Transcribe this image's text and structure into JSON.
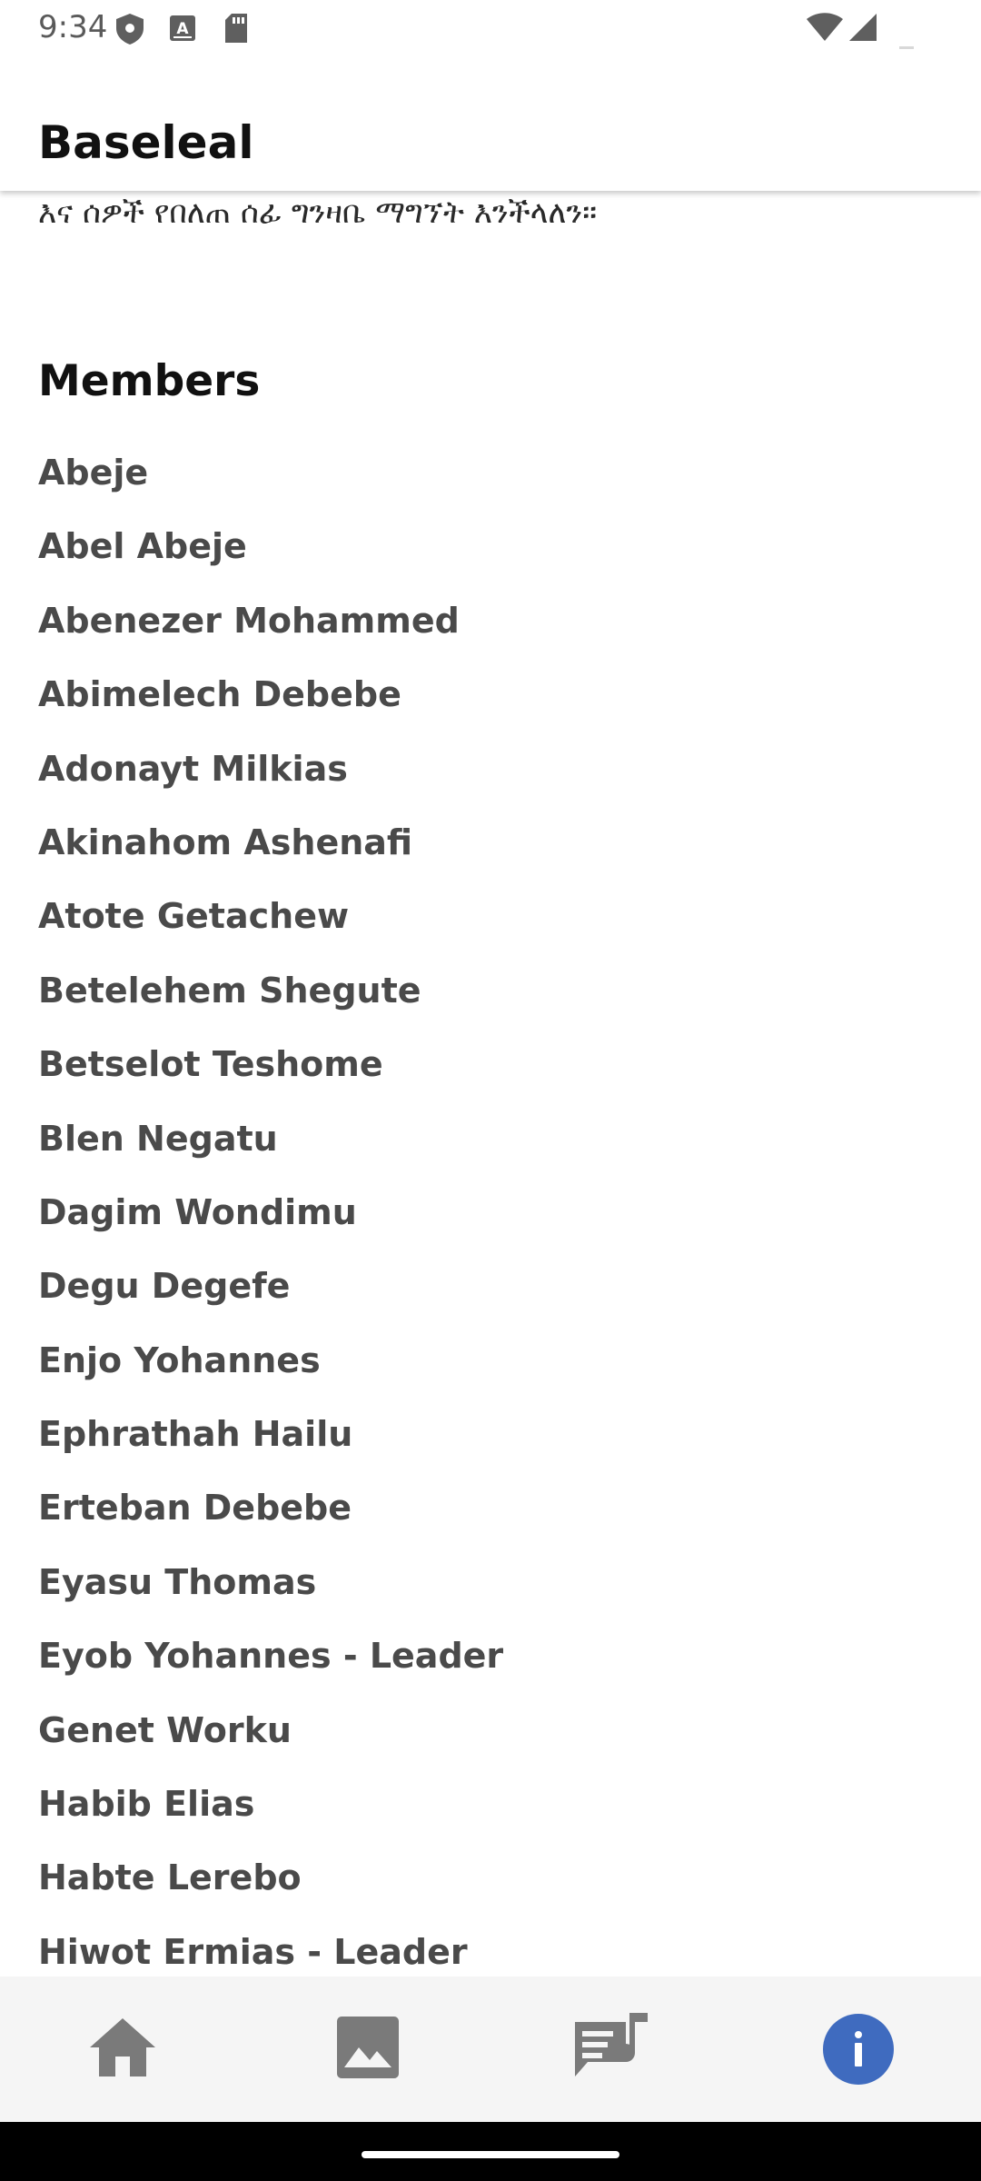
{
  "status_bar": {
    "time": "9:34"
  },
  "app_bar": {
    "title": "Baseleal"
  },
  "content": {
    "intro_text": "እና ሰዎች የበለጠ ሰፊ ግንዛቤ ማግኘት እንችላለን።",
    "members_heading": "Members",
    "members": [
      "Abeje",
      "Abel Abeje",
      "Abenezer Mohammed",
      "Abimelech Debebe",
      "Adonayt Milkias",
      "Akinahom Ashenafi",
      "Atote Getachew",
      "Betelehem Shegute",
      "Betselot Teshome",
      "Blen Negatu",
      "Dagim Wondimu",
      "Degu Degefe",
      "Enjo Yohannes",
      "Ephrathah Hailu",
      "Erteban Debebe",
      "Eyasu Thomas",
      "Eyob Yohannes - Leader",
      "Genet Worku",
      "Habib Elias",
      "Habte Lerebo",
      "Hiwot Ermias - Leader"
    ]
  },
  "bottom_nav": {
    "items": [
      {
        "icon": "home-icon",
        "selected": false
      },
      {
        "icon": "gallery-icon",
        "selected": false
      },
      {
        "icon": "lyrics-icon",
        "selected": false
      },
      {
        "icon": "info-icon",
        "selected": true
      }
    ]
  },
  "colors": {
    "nav_icon_inactive": "#7a7a7a",
    "nav_active_bg": "#3f6bbf",
    "member_text": "#4a4a4a",
    "heading_text": "#111111"
  }
}
